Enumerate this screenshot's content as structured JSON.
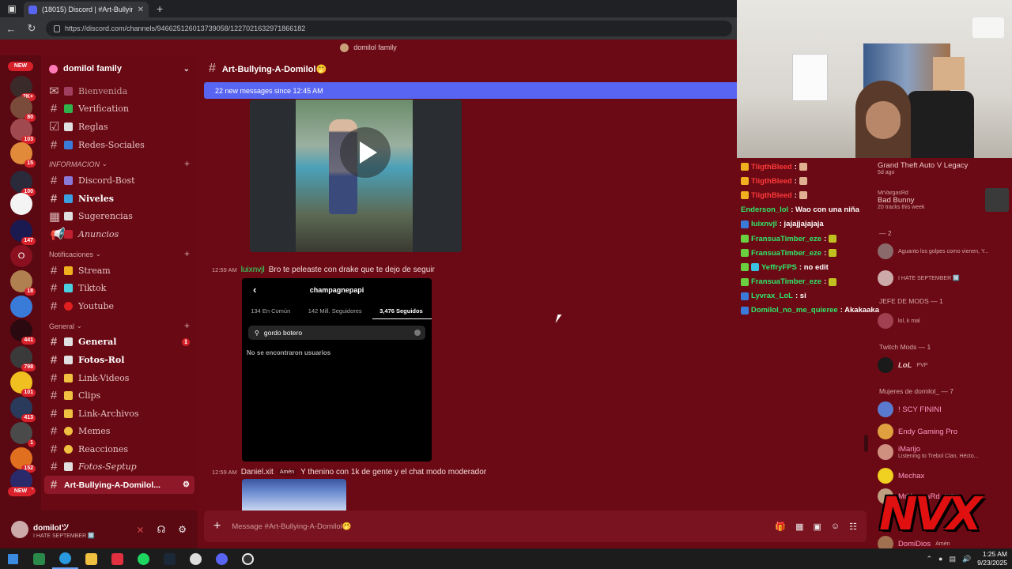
{
  "browser": {
    "tab_title": "(18015) Discord | #Art-Bullying-A",
    "url": "https://discord.com/channels/946625126013739058/1227021632971866182",
    "server_title": "domilol family"
  },
  "rail": {
    "new_top": "NEW",
    "new_bottom": "NEW",
    "counts": [
      "18",
      "2K+",
      "80",
      "103",
      "15",
      "100",
      "147",
      "441",
      "798",
      "101",
      "413",
      "1",
      "152",
      "20"
    ],
    "letter": "O"
  },
  "sidebar": {
    "server_name": "domilol family",
    "items_top": [
      {
        "label": "Bienvenida",
        "color": "#a04060"
      },
      {
        "label": "Verification",
        "color": "#2fb34a"
      },
      {
        "label": "Reglas",
        "color": "#e0e0e0"
      },
      {
        "label": "Redes-Sociales",
        "color": "#3a7ad8"
      }
    ],
    "cat_info": "INFORMACION",
    "items_info": [
      {
        "label": "Discord-Bost",
        "color": "#8a7ad8"
      },
      {
        "label": "Niveles",
        "color": "#3aa0e0"
      },
      {
        "label": "Sugerencias",
        "color": "#e0e0e0"
      },
      {
        "label": "Anuncios",
        "color": "#c02030"
      }
    ],
    "cat_notif": "Notificaciones",
    "items_notif": [
      {
        "label": "Stream",
        "color": "#f0b020"
      },
      {
        "label": "Tiktok",
        "color": "#4ad0e0"
      },
      {
        "label": "Youtube",
        "color": "#e02020"
      }
    ],
    "cat_general": "General",
    "items_general": [
      {
        "label": "General",
        "color": "#e0e0e0",
        "badge": "1"
      },
      {
        "label": "Fotos-Rol",
        "color": "#e0e0e0"
      },
      {
        "label": "Link-Videos",
        "color": "#f0c040"
      },
      {
        "label": "Clips",
        "color": "#f0c040"
      },
      {
        "label": "Link-Archivos",
        "color": "#f0c040"
      },
      {
        "label": "Memes",
        "color": "#f0c040"
      },
      {
        "label": "Reacciones",
        "color": "#f0c040"
      },
      {
        "label": "Fotos-Septup",
        "color": "#e0e0e0"
      }
    ],
    "selected": "Art-Bullying-A-Domilol..."
  },
  "user": {
    "name": "domiloIツ",
    "status": "I HATE SEPTEMBER 🔟"
  },
  "channel": {
    "name": "Art-Bullying-A-Domilol🤭",
    "new_messages": "22 new messages since 12:45 AM",
    "composer_placeholder": "Message #Art-Bullying-A-Domilol🤭"
  },
  "messages": [
    {
      "time": "12:59 AM",
      "author": "luixnvjl",
      "author_color": "#2ee86a",
      "text": "Bro te peleaste con drake que te dejo de seguir"
    },
    {
      "time": "12:59 AM",
      "author": "Daniel.xit",
      "author_color": "#f4dcdc",
      "tag": "Amén",
      "text": "Y thenino con 1k de gente y el chat modo moderador"
    }
  ],
  "instagram": {
    "username": "champagnepapi",
    "tabs": [
      "134 En Común",
      "142 Mill. Seguidores",
      "3,476 Seguidos"
    ],
    "search": "gordo botero",
    "empty": "No se encontraron usuarios"
  },
  "stream_chat": [
    {
      "user": "TligthBleed",
      "text": ":",
      "color": "red"
    },
    {
      "user": "TligthBleed",
      "text": ":",
      "color": "red"
    },
    {
      "user": "TligthBleed",
      "text": ":",
      "color": "red"
    },
    {
      "user": "Enderson_lol",
      "text": ": Wao con una niña",
      "color": "green"
    },
    {
      "user": "luixnvjl",
      "text": ": jajajjajajaja",
      "color": "green"
    },
    {
      "user": "FransuaTimber_eze",
      "text": ":",
      "color": "green"
    },
    {
      "user": "FransuaTimber_eze",
      "text": ":",
      "color": "green"
    },
    {
      "user": "YeffryFPS",
      "text": ": no edit",
      "color": "green"
    },
    {
      "user": "FransuaTimber_eze",
      "text": ":",
      "color": "green"
    },
    {
      "user": "Lyvrax_LoL",
      "text": ": si",
      "color": "green"
    },
    {
      "user": "Domilol_no_me_quieree",
      "text": ": Akakaaka",
      "color": "green"
    }
  ],
  "members": {
    "activity1": {
      "title": "Grand Theft Auto V Legacy",
      "sub": "5d ago"
    },
    "activity2": {
      "name": "MrVargasRd",
      "title": "Bad Bunny",
      "sub": "20 tracks this week"
    },
    "cat_dash": "— 2",
    "m1": {
      "name": "Aguanto los golpes como vienen, Y..."
    },
    "m2": {
      "name": "I HATE SEPTEMBER 🔟"
    },
    "cat_jefe": "JEFE DE MODS — 1",
    "m3": {
      "name": "lol, k mal"
    },
    "cat_twitch": "Twitch Mods — 1",
    "m4": {
      "name": "LoL",
      "tag": "PVP"
    },
    "cat_mujeres": "Mujeres de domilol_ — 7",
    "m5": {
      "name": "! SCY FININI"
    },
    "m6": {
      "name": "Endy Gaming Pro"
    },
    "m7": {
      "name": "iMarijo",
      "sub": "Listening to Trebol Clan, Hécto..."
    },
    "m8": {
      "name": "Mechax"
    },
    "m9": {
      "name": "MrVargasRd",
      "tag": "NICK"
    },
    "m10": {
      "name": "DomiDios",
      "tag": "Amén"
    }
  },
  "overlay": {
    "logo": "NVX"
  },
  "taskbar": {
    "time": "1:25 AM",
    "date": "9/23/2025"
  }
}
